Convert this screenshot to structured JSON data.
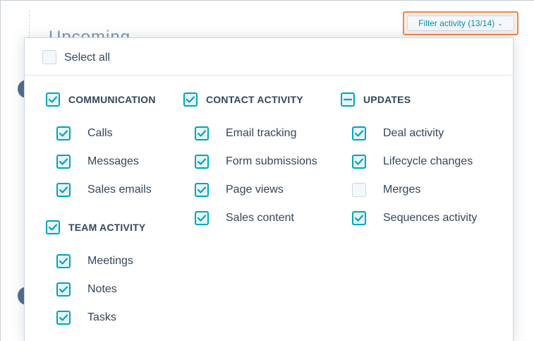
{
  "background": {
    "section_title": "Upcoming"
  },
  "filter_button": {
    "label": "Filter activity (13/14)",
    "chevron_icon": "chevron-down-icon",
    "highlight_color": "#f2854e"
  },
  "dropdown": {
    "select_all": {
      "label": "Select all",
      "state": "unchecked"
    },
    "groups": [
      {
        "label": "COMMUNICATION",
        "state": "checked",
        "items": [
          {
            "label": "Calls",
            "state": "checked"
          },
          {
            "label": "Messages",
            "state": "checked"
          },
          {
            "label": "Sales emails",
            "state": "checked"
          }
        ]
      },
      {
        "label": "TEAM ACTIVITY",
        "state": "checked",
        "items": [
          {
            "label": "Meetings",
            "state": "checked"
          },
          {
            "label": "Notes",
            "state": "checked"
          },
          {
            "label": "Tasks",
            "state": "checked"
          }
        ]
      },
      {
        "label": "CONTACT ACTIVITY",
        "state": "checked",
        "items": [
          {
            "label": "Email tracking",
            "state": "checked"
          },
          {
            "label": "Form submissions",
            "state": "checked"
          },
          {
            "label": "Page views",
            "state": "checked"
          },
          {
            "label": "Sales content",
            "state": "checked"
          }
        ]
      },
      {
        "label": "UPDATES",
        "state": "partial",
        "items": [
          {
            "label": "Deal activity",
            "state": "checked"
          },
          {
            "label": "Lifecycle changes",
            "state": "checked"
          },
          {
            "label": "Merges",
            "state": "unchecked"
          },
          {
            "label": "Sequences activity",
            "state": "checked"
          }
        ]
      }
    ]
  },
  "colors": {
    "accent": "#00a4bd",
    "text": "#33475b",
    "link": "#0091ae"
  }
}
